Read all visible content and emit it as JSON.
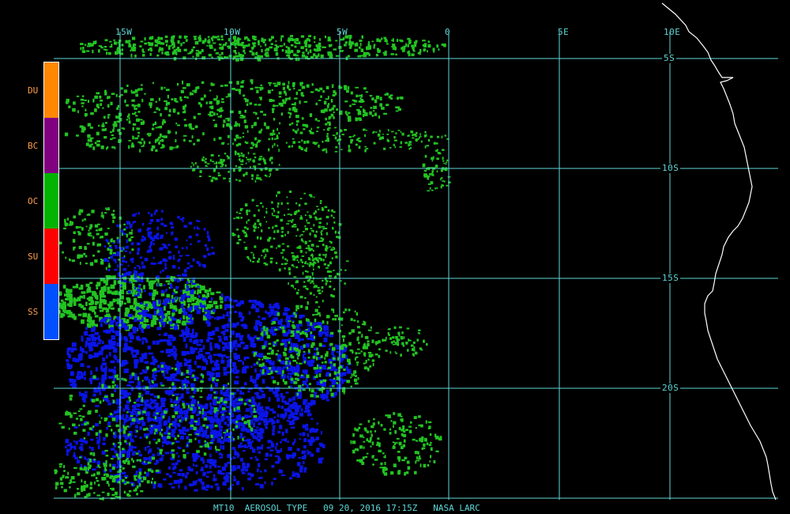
{
  "title": {
    "product": "MT10",
    "field": "AEROSOL TYPE",
    "datetime": "09 20, 2016 17:15Z",
    "source": "NASA LARC"
  },
  "lon_labels": [
    "15W",
    "10W",
    "5W",
    "0",
    "5E",
    "10E"
  ],
  "lat_labels": [
    "5S",
    "10S",
    "15S",
    "20S"
  ],
  "legend": {
    "items": [
      {
        "label": "DU",
        "color": "#ff8800"
      },
      {
        "label": "BC",
        "color": "#800080"
      },
      {
        "label": "OC",
        "color": "#00b400"
      },
      {
        "label": "SU",
        "color": "#ff0000"
      },
      {
        "label": "SS",
        "color": "#0050ff"
      }
    ]
  },
  "colors": {
    "grid": "#5fd7d7",
    "coastline": "#ffffff",
    "oc_pixels": "#22c322",
    "ss_pixels": "#0a14e6",
    "background": "#000000"
  }
}
